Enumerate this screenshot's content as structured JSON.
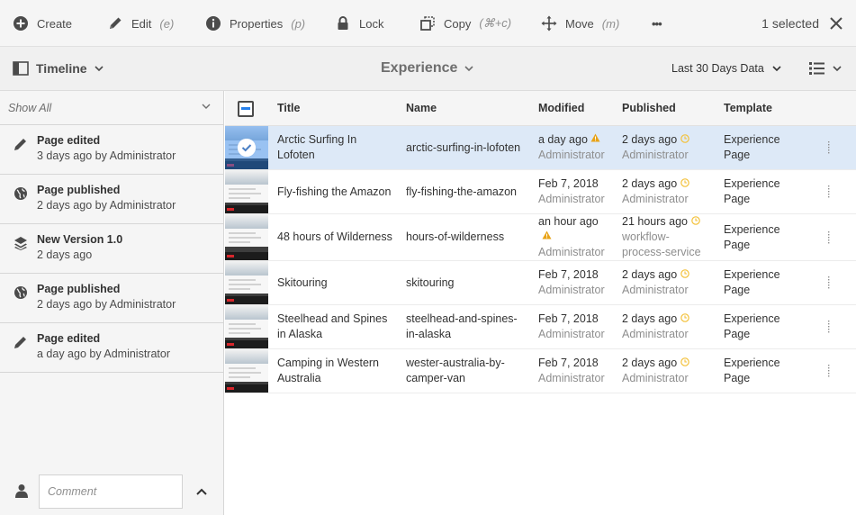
{
  "actionbar": {
    "create": "Create",
    "edit": "Edit",
    "edit_shortcut": "(e)",
    "properties": "Properties",
    "properties_shortcut": "(p)",
    "lock": "Lock",
    "copy": "Copy",
    "copy_shortcut": "(⌘+c)",
    "move": "Move",
    "move_shortcut": "(m)",
    "more": "•••",
    "selected_count": "1 selected"
  },
  "toolbar": {
    "rail_label": "Timeline",
    "title": "Experience",
    "range": "Last 30 Days Data"
  },
  "sidebar": {
    "filter": "Show All",
    "items": [
      {
        "icon": "pencil-icon",
        "title": "Page edited",
        "sub": "3 days ago by Administrator"
      },
      {
        "icon": "globe-icon",
        "title": "Page published",
        "sub": "2 days ago by Administrator"
      },
      {
        "icon": "layers-icon",
        "title": "New Version 1.0",
        "sub": "2 days ago"
      },
      {
        "icon": "globe-icon",
        "title": "Page published",
        "sub": "2 days ago by Administrator"
      },
      {
        "icon": "pencil-icon",
        "title": "Page edited",
        "sub": "a day ago by Administrator"
      }
    ],
    "comment_placeholder": "Comment"
  },
  "table": {
    "headers": {
      "title": "Title",
      "name": "Name",
      "modified": "Modified",
      "published": "Published",
      "template": "Template"
    },
    "rows": [
      {
        "title1": "Arctic Surfing In",
        "title2": "Lofoten",
        "name1": "arctic-surfing-in-lofoten",
        "name2": "",
        "mod1": "a day ago",
        "mod_warn": true,
        "mod_warn_inline": true,
        "mod2": "Administrator",
        "pub1": "2 days ago",
        "pub2": "Administrator",
        "tpl1": "Experience",
        "tpl2": "Page",
        "selected": true
      },
      {
        "title1": "Fly-fishing the Amazon",
        "title2": "",
        "name1": "fly-fishing-the-amazon",
        "name2": "",
        "mod1": "Feb 7, 2018",
        "mod_warn": false,
        "mod2": "Administrator",
        "pub1": "2 days ago",
        "pub2": "Administrator",
        "tpl1": "Experience",
        "tpl2": "Page",
        "selected": false
      },
      {
        "title1": "48 hours of Wilderness",
        "title2": "",
        "name1": "hours-of-wilderness",
        "name2": "",
        "mod1": "an hour ago",
        "mod_warn": true,
        "mod_warn_inline": false,
        "mod2": "Administrator",
        "pub1": "21 hours ago",
        "pub2": "workflow-",
        "pub3": "process-service",
        "tpl1": "Experience",
        "tpl2": "Page",
        "selected": false
      },
      {
        "title1": "Skitouring",
        "title2": "",
        "name1": "skitouring",
        "name2": "",
        "mod1": "Feb 7, 2018",
        "mod_warn": false,
        "mod2": "Administrator",
        "pub1": "2 days ago",
        "pub2": "Administrator",
        "tpl1": "Experience",
        "tpl2": "Page",
        "selected": false
      },
      {
        "title1": "Steelhead and Spines",
        "title2": "in Alaska",
        "name1": "steelhead-and-spines-",
        "name2": "in-alaska",
        "mod1": "Feb 7, 2018",
        "mod_warn": false,
        "mod2": "Administrator",
        "pub1": "2 days ago",
        "pub2": "Administrator",
        "tpl1": "Experience",
        "tpl2": "Page",
        "selected": false
      },
      {
        "title1": "Camping in Western",
        "title2": "Australia",
        "name1": "wester-australia-by-",
        "name2": "camper-van",
        "mod1": "Feb 7, 2018",
        "mod_warn": false,
        "mod2": "Administrator",
        "pub1": "2 days ago",
        "pub2": "Administrator",
        "tpl1": "Experience",
        "tpl2": "Page",
        "selected": false
      }
    ]
  },
  "colors": {
    "accent": "#2680eb",
    "warning": "#e8a317",
    "clock": "#f3c13a"
  }
}
